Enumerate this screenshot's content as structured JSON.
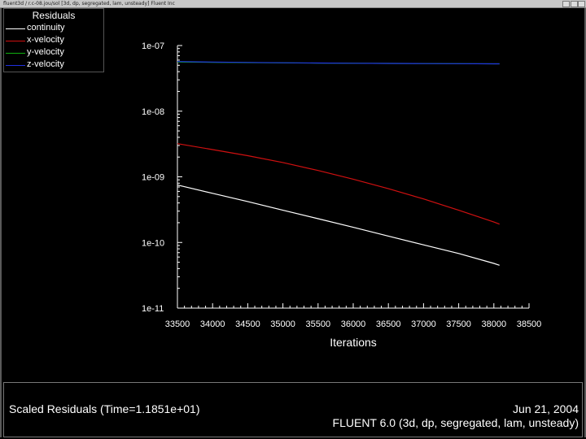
{
  "window": {
    "title": "fluent3d / r.c-08.jou/sol [3d, dp, segregated, lam, unsteady] Fluent Inc"
  },
  "colors": {
    "background": "#000000",
    "continuity": "#ffffff",
    "x_velocity": "#d01010",
    "y_velocity": "#10b010",
    "z_velocity": "#2030e0"
  },
  "legend": {
    "title": "Residuals",
    "items": [
      {
        "label": "continuity",
        "color": "#ffffff"
      },
      {
        "label": "x-velocity",
        "color": "#d01010"
      },
      {
        "label": "y-velocity",
        "color": "#10b010"
      },
      {
        "label": "z-velocity",
        "color": "#2030e0"
      }
    ]
  },
  "info": {
    "left": "Scaled Residuals  (Time=1.1851e+01)",
    "date": "Jun 21, 2004",
    "solver": "FLUENT 6.0 (3d, dp, segregated, lam, unsteady)"
  },
  "chart_data": {
    "type": "line",
    "title": "",
    "xlabel": "Iterations",
    "ylabel": "",
    "xlim": [
      33500,
      38500
    ],
    "ylim": [
      1e-11,
      1e-07
    ],
    "y_scale": "log",
    "x_ticks": [
      33500,
      34000,
      34500,
      35000,
      35500,
      36000,
      36500,
      37000,
      37500,
      38000,
      38500
    ],
    "x_tick_labels": [
      "33500",
      "34000",
      "34500",
      "35000",
      "35500",
      "36000",
      "36500",
      "37000",
      "37500",
      "38000",
      "38500"
    ],
    "y_ticks": [
      1e-11,
      1e-10,
      1e-09,
      1e-08,
      1e-07
    ],
    "y_tick_labels": [
      "1e-11",
      "1e-10",
      "1e-09",
      "1e-08",
      "1e-07"
    ],
    "grid": false,
    "legend_position": "top-left",
    "series": [
      {
        "name": "continuity",
        "color": "#ffffff",
        "x": [
          33500,
          34000,
          34500,
          35000,
          35500,
          36000,
          36500,
          37000,
          37500,
          38000,
          38080
        ],
        "y": [
          7.5e-10,
          5.6e-10,
          4.2e-10,
          3.1e-10,
          2.3e-10,
          1.7e-10,
          1.25e-10,
          9.2e-11,
          6.8e-11,
          4.8e-11,
          4.5e-11
        ]
      },
      {
        "name": "x-velocity",
        "color": "#d01010",
        "x": [
          33500,
          34000,
          34500,
          35000,
          35500,
          36000,
          36500,
          37000,
          37500,
          38000,
          38080
        ],
        "y": [
          3.2e-09,
          2.6e-09,
          2.1e-09,
          1.65e-09,
          1.25e-09,
          9.2e-10,
          6.6e-10,
          4.6e-10,
          3.1e-10,
          2.05e-10,
          1.9e-10
        ]
      },
      {
        "name": "y-velocity",
        "color": "#10b010",
        "x": [
          33500,
          34000,
          34500,
          35000,
          35500,
          36000,
          36500,
          37000,
          37500,
          38000,
          38080
        ],
        "y": [
          5.6e-08,
          5.55e-08,
          5.5e-08,
          5.45e-08,
          5.4e-08,
          5.37e-08,
          5.34e-08,
          5.31e-08,
          5.29e-08,
          5.27e-08,
          5.27e-08
        ]
      },
      {
        "name": "z-velocity",
        "color": "#2030e0",
        "x": [
          33500,
          34000,
          34500,
          35000,
          35500,
          36000,
          36500,
          37000,
          37500,
          38000,
          38080
        ],
        "y": [
          5.7e-08,
          5.6e-08,
          5.52e-08,
          5.46e-08,
          5.41e-08,
          5.37e-08,
          5.34e-08,
          5.31e-08,
          5.29e-08,
          5.27e-08,
          5.27e-08
        ]
      }
    ]
  }
}
